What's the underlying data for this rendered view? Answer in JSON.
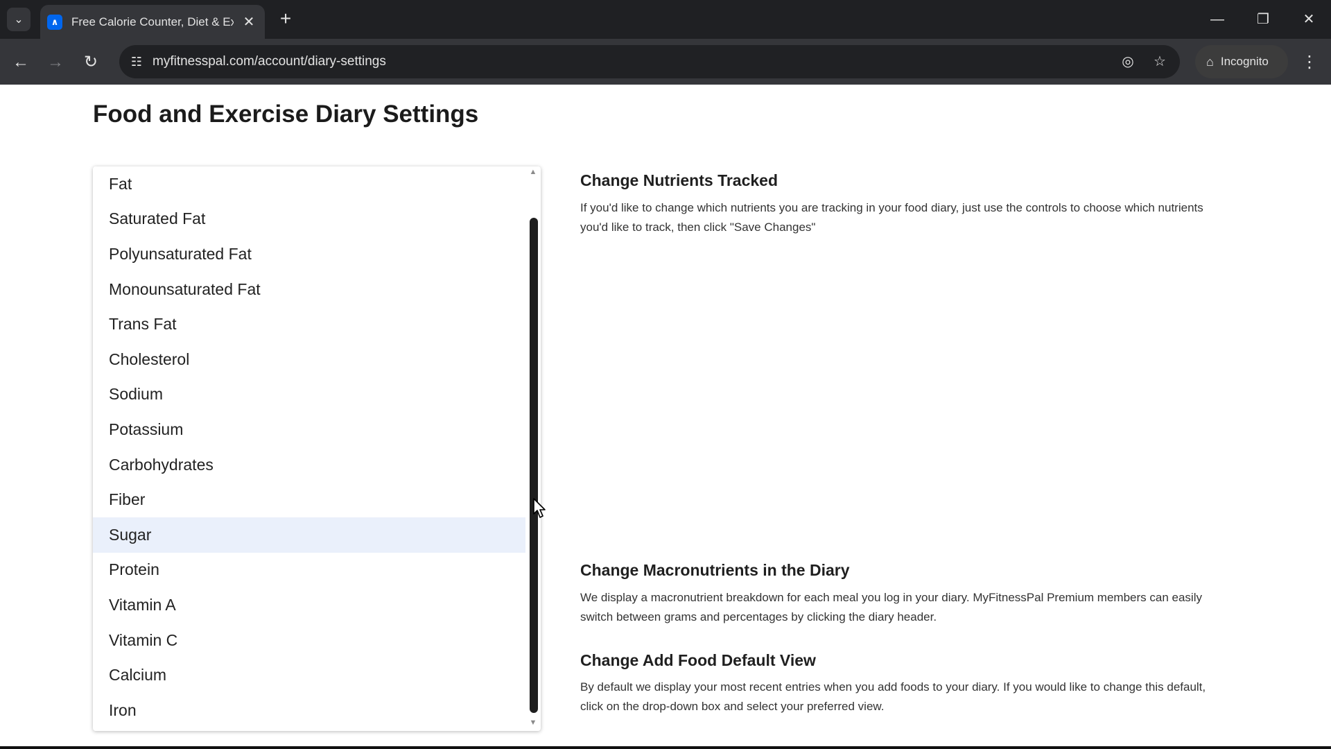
{
  "browser": {
    "tab": {
      "title": "Free Calorie Counter, Diet & Exercise Journal",
      "favicon_letter": "∧",
      "close_glyph": "✕"
    },
    "tab_search_glyph": "⌄",
    "new_tab_glyph": "+",
    "window_controls": {
      "minimize": "—",
      "restore": "❐",
      "close": "✕"
    },
    "nav": {
      "back": "←",
      "forward": "→",
      "reload": "↻"
    },
    "site_info_glyph": "☷",
    "url": "myfitnesspal.com/account/diary-settings",
    "tracking_glyph": "◎",
    "bookmark_glyph": "☆",
    "incognito_glyph": "⌂",
    "incognito_label": "Incognito",
    "menu_glyph": "⋮"
  },
  "page": {
    "title": "Food and Exercise Diary Settings"
  },
  "nutrient_list": {
    "items": [
      "Fat",
      "Saturated Fat",
      "Polyunsaturated Fat",
      "Monounsaturated Fat",
      "Trans Fat",
      "Cholesterol",
      "Sodium",
      "Potassium",
      "Carbohydrates",
      "Fiber",
      "Sugar",
      "Protein",
      "Vitamin A",
      "Vitamin C",
      "Calcium",
      "Iron"
    ],
    "highlighted": "Sugar",
    "scroll_up_glyph": "▲",
    "scroll_down_glyph": "▼"
  },
  "sections": [
    {
      "heading": "Change Nutrients Tracked",
      "text": "If you'd like to change which nutrients you are tracking in your food diary, just use the controls to choose which nutrients you'd like to track, then click \"Save Changes\""
    },
    {
      "heading": "Change Macronutrients in the Diary",
      "text": "We display a macronutrient breakdown for each meal you log in your diary. MyFitnessPal Premium members can easily switch between grams and percentages by clicking the diary header."
    },
    {
      "heading": "Change Add Food Default View",
      "text": "By default we display your most recent entries when you add foods to your diary. If you would like to change this default, click on the drop-down box and select your preferred view."
    }
  ],
  "colors": {
    "tabstrip": "#1f2023",
    "toolbar": "#35363a",
    "highlight_row": "#eaf0fb",
    "scroll_thumb": "#1f1f1f"
  }
}
